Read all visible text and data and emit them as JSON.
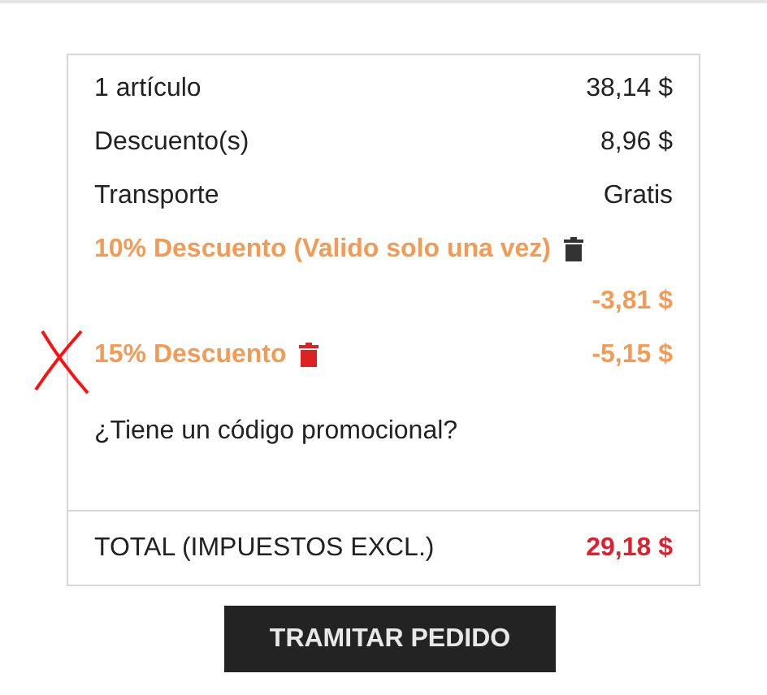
{
  "summary": [
    {
      "label": "1 artículo",
      "value": "38,14 $"
    },
    {
      "label": "Descuento(s)",
      "value": "8,96 $"
    },
    {
      "label": "Transporte",
      "value": "Gratis"
    }
  ],
  "discounts": [
    {
      "label": "10% Descuento (Valido solo una vez)",
      "amount": "-3,81 $",
      "kind": "wrapped",
      "color": "#333333",
      "crossed_out": false
    },
    {
      "label": "15% Descuento",
      "amount": "-5,15 $",
      "kind": "inline",
      "color": "#dd2222",
      "crossed_out": true
    }
  ],
  "promo_link": "¿Tiene un código promocional?",
  "total": {
    "label": "TOTAL (IMPUESTOS EXCL.)",
    "value": "29,18 $"
  },
  "checkout_button": "TRAMITAR PEDIDO"
}
